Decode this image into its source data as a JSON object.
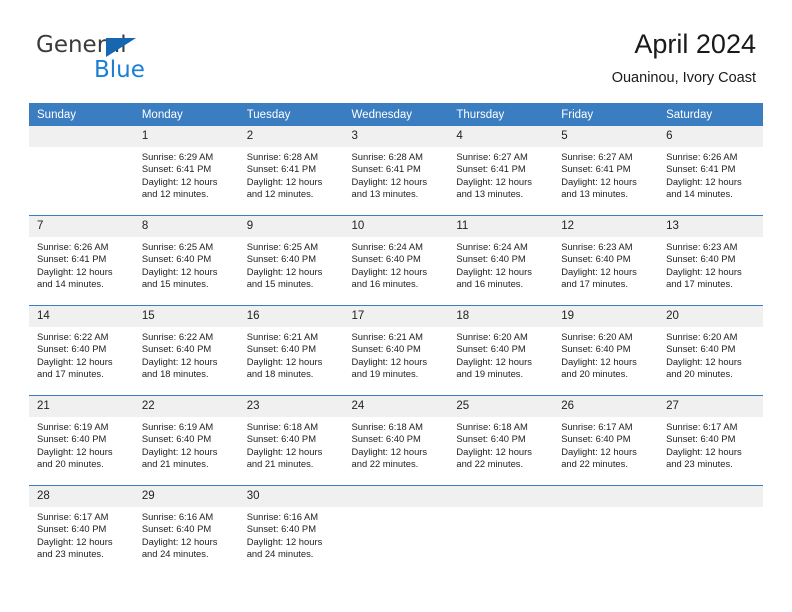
{
  "brand": {
    "name_part1": "General",
    "name_part2": "Blue",
    "triangle_color": "#1666b0"
  },
  "header": {
    "title": "April 2024",
    "subtitle": "Ouaninou, Ivory Coast",
    "header_bg": "#3a7dc0"
  },
  "weekdays": [
    "Sunday",
    "Monday",
    "Tuesday",
    "Wednesday",
    "Thursday",
    "Friday",
    "Saturday"
  ],
  "weeks": [
    [
      {
        "day": ""
      },
      {
        "day": "1",
        "sunrise": "Sunrise: 6:29 AM",
        "sunset": "Sunset: 6:41 PM",
        "daylight1": "Daylight: 12 hours",
        "daylight2": "and 12 minutes."
      },
      {
        "day": "2",
        "sunrise": "Sunrise: 6:28 AM",
        "sunset": "Sunset: 6:41 PM",
        "daylight1": "Daylight: 12 hours",
        "daylight2": "and 12 minutes."
      },
      {
        "day": "3",
        "sunrise": "Sunrise: 6:28 AM",
        "sunset": "Sunset: 6:41 PM",
        "daylight1": "Daylight: 12 hours",
        "daylight2": "and 13 minutes."
      },
      {
        "day": "4",
        "sunrise": "Sunrise: 6:27 AM",
        "sunset": "Sunset: 6:41 PM",
        "daylight1": "Daylight: 12 hours",
        "daylight2": "and 13 minutes."
      },
      {
        "day": "5",
        "sunrise": "Sunrise: 6:27 AM",
        "sunset": "Sunset: 6:41 PM",
        "daylight1": "Daylight: 12 hours",
        "daylight2": "and 13 minutes."
      },
      {
        "day": "6",
        "sunrise": "Sunrise: 6:26 AM",
        "sunset": "Sunset: 6:41 PM",
        "daylight1": "Daylight: 12 hours",
        "daylight2": "and 14 minutes."
      }
    ],
    [
      {
        "day": "7",
        "sunrise": "Sunrise: 6:26 AM",
        "sunset": "Sunset: 6:41 PM",
        "daylight1": "Daylight: 12 hours",
        "daylight2": "and 14 minutes."
      },
      {
        "day": "8",
        "sunrise": "Sunrise: 6:25 AM",
        "sunset": "Sunset: 6:40 PM",
        "daylight1": "Daylight: 12 hours",
        "daylight2": "and 15 minutes."
      },
      {
        "day": "9",
        "sunrise": "Sunrise: 6:25 AM",
        "sunset": "Sunset: 6:40 PM",
        "daylight1": "Daylight: 12 hours",
        "daylight2": "and 15 minutes."
      },
      {
        "day": "10",
        "sunrise": "Sunrise: 6:24 AM",
        "sunset": "Sunset: 6:40 PM",
        "daylight1": "Daylight: 12 hours",
        "daylight2": "and 16 minutes."
      },
      {
        "day": "11",
        "sunrise": "Sunrise: 6:24 AM",
        "sunset": "Sunset: 6:40 PM",
        "daylight1": "Daylight: 12 hours",
        "daylight2": "and 16 minutes."
      },
      {
        "day": "12",
        "sunrise": "Sunrise: 6:23 AM",
        "sunset": "Sunset: 6:40 PM",
        "daylight1": "Daylight: 12 hours",
        "daylight2": "and 17 minutes."
      },
      {
        "day": "13",
        "sunrise": "Sunrise: 6:23 AM",
        "sunset": "Sunset: 6:40 PM",
        "daylight1": "Daylight: 12 hours",
        "daylight2": "and 17 minutes."
      }
    ],
    [
      {
        "day": "14",
        "sunrise": "Sunrise: 6:22 AM",
        "sunset": "Sunset: 6:40 PM",
        "daylight1": "Daylight: 12 hours",
        "daylight2": "and 17 minutes."
      },
      {
        "day": "15",
        "sunrise": "Sunrise: 6:22 AM",
        "sunset": "Sunset: 6:40 PM",
        "daylight1": "Daylight: 12 hours",
        "daylight2": "and 18 minutes."
      },
      {
        "day": "16",
        "sunrise": "Sunrise: 6:21 AM",
        "sunset": "Sunset: 6:40 PM",
        "daylight1": "Daylight: 12 hours",
        "daylight2": "and 18 minutes."
      },
      {
        "day": "17",
        "sunrise": "Sunrise: 6:21 AM",
        "sunset": "Sunset: 6:40 PM",
        "daylight1": "Daylight: 12 hours",
        "daylight2": "and 19 minutes."
      },
      {
        "day": "18",
        "sunrise": "Sunrise: 6:20 AM",
        "sunset": "Sunset: 6:40 PM",
        "daylight1": "Daylight: 12 hours",
        "daylight2": "and 19 minutes."
      },
      {
        "day": "19",
        "sunrise": "Sunrise: 6:20 AM",
        "sunset": "Sunset: 6:40 PM",
        "daylight1": "Daylight: 12 hours",
        "daylight2": "and 20 minutes."
      },
      {
        "day": "20",
        "sunrise": "Sunrise: 6:20 AM",
        "sunset": "Sunset: 6:40 PM",
        "daylight1": "Daylight: 12 hours",
        "daylight2": "and 20 minutes."
      }
    ],
    [
      {
        "day": "21",
        "sunrise": "Sunrise: 6:19 AM",
        "sunset": "Sunset: 6:40 PM",
        "daylight1": "Daylight: 12 hours",
        "daylight2": "and 20 minutes."
      },
      {
        "day": "22",
        "sunrise": "Sunrise: 6:19 AM",
        "sunset": "Sunset: 6:40 PM",
        "daylight1": "Daylight: 12 hours",
        "daylight2": "and 21 minutes."
      },
      {
        "day": "23",
        "sunrise": "Sunrise: 6:18 AM",
        "sunset": "Sunset: 6:40 PM",
        "daylight1": "Daylight: 12 hours",
        "daylight2": "and 21 minutes."
      },
      {
        "day": "24",
        "sunrise": "Sunrise: 6:18 AM",
        "sunset": "Sunset: 6:40 PM",
        "daylight1": "Daylight: 12 hours",
        "daylight2": "and 22 minutes."
      },
      {
        "day": "25",
        "sunrise": "Sunrise: 6:18 AM",
        "sunset": "Sunset: 6:40 PM",
        "daylight1": "Daylight: 12 hours",
        "daylight2": "and 22 minutes."
      },
      {
        "day": "26",
        "sunrise": "Sunrise: 6:17 AM",
        "sunset": "Sunset: 6:40 PM",
        "daylight1": "Daylight: 12 hours",
        "daylight2": "and 22 minutes."
      },
      {
        "day": "27",
        "sunrise": "Sunrise: 6:17 AM",
        "sunset": "Sunset: 6:40 PM",
        "daylight1": "Daylight: 12 hours",
        "daylight2": "and 23 minutes."
      }
    ],
    [
      {
        "day": "28",
        "sunrise": "Sunrise: 6:17 AM",
        "sunset": "Sunset: 6:40 PM",
        "daylight1": "Daylight: 12 hours",
        "daylight2": "and 23 minutes."
      },
      {
        "day": "29",
        "sunrise": "Sunrise: 6:16 AM",
        "sunset": "Sunset: 6:40 PM",
        "daylight1": "Daylight: 12 hours",
        "daylight2": "and 24 minutes."
      },
      {
        "day": "30",
        "sunrise": "Sunrise: 6:16 AM",
        "sunset": "Sunset: 6:40 PM",
        "daylight1": "Daylight: 12 hours",
        "daylight2": "and 24 minutes."
      },
      {
        "day": ""
      },
      {
        "day": ""
      },
      {
        "day": ""
      },
      {
        "day": ""
      }
    ]
  ]
}
